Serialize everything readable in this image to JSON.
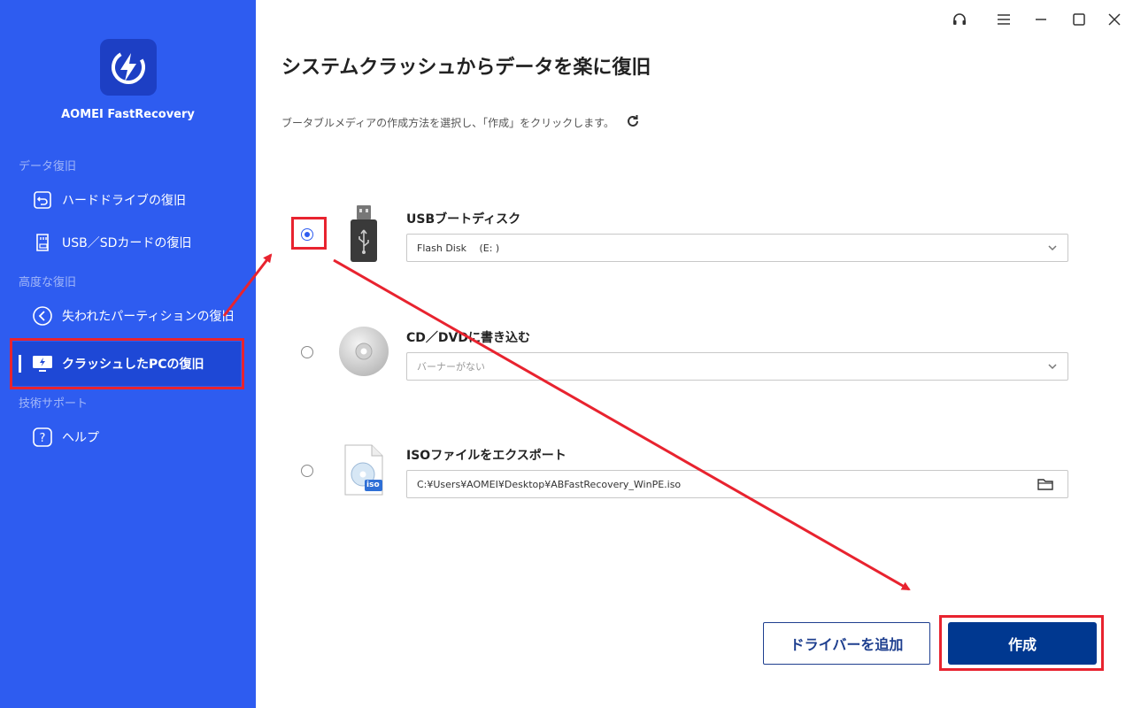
{
  "app": {
    "name": "AOMEI FastRecovery",
    "brand_color": "#2e5cf0",
    "accent_dark": "#003890",
    "highlight_color": "#e8232f"
  },
  "sidebar": {
    "sections": [
      {
        "label": "データ復旧",
        "items": [
          {
            "label": "ハードドライブの復旧",
            "icon": "restore-icon"
          },
          {
            "label": "USB／SDカードの復旧",
            "icon": "sd-card-icon"
          }
        ]
      },
      {
        "label": "高度な復旧",
        "items": [
          {
            "label": "失われたパーティションの復旧",
            "icon": "partition-icon"
          },
          {
            "label": "クラッシュしたPCの復旧",
            "icon": "crashed-pc-icon",
            "active": true
          }
        ]
      },
      {
        "label": "技術サポート",
        "items": [
          {
            "label": "ヘルプ",
            "icon": "help-icon"
          }
        ]
      }
    ]
  },
  "window_controls": [
    "headset-icon",
    "menu-icon",
    "minimize-icon",
    "maximize-icon",
    "close-icon"
  ],
  "main": {
    "title": "システムクラッシュからデータを楽に復旧",
    "subtitle": "ブータブルメディアの作成方法を選択し、「作成」をクリックします。",
    "options": [
      {
        "label": "USBブートディスク",
        "value": "Flash Disk　 (E: )",
        "selected": true,
        "icon": "usb-drive-icon"
      },
      {
        "label": "CD／DVDに書き込む",
        "placeholder": "バーナーがない",
        "selected": false,
        "icon": "cd-disc-icon"
      },
      {
        "label": "ISOファイルをエクスポート",
        "value": "C:¥Users¥AOMEI¥Desktop¥ABFastRecovery_WinPE.iso",
        "selected": false,
        "icon": "iso-file-icon",
        "iso_badge": "iso"
      }
    ],
    "buttons": {
      "add_driver": "ドライバーを追加",
      "create": "作成"
    }
  }
}
